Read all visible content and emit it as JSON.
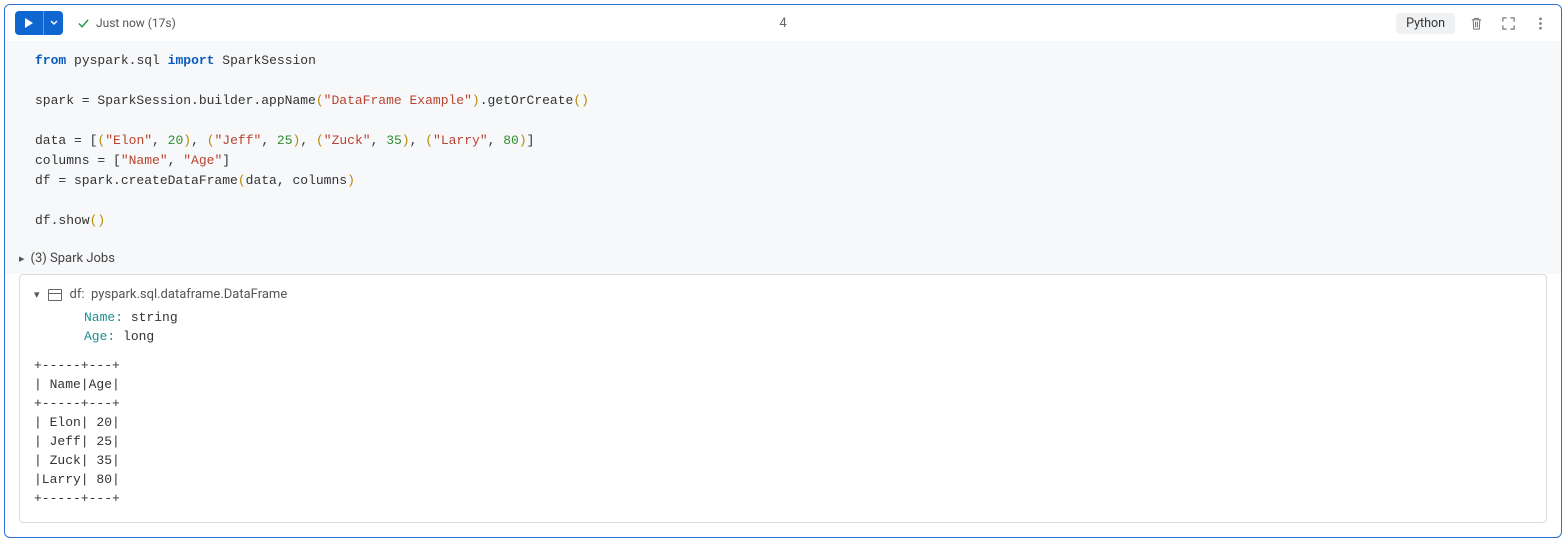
{
  "toolbar": {
    "status_text": "Just now (17s)",
    "execution_count": "4",
    "language": "Python"
  },
  "code": {
    "line1_from": "from",
    "line1_mod": "pyspark.sql",
    "line1_import": "import",
    "line1_cls": "SparkSession",
    "line3_a": "spark = SparkSession.builder.appName",
    "line3_op": "(",
    "line3_str": "\"DataFrame Example\"",
    "line3_cp": ")",
    "line3_b": ".getOrCreate",
    "line3_op2": "(",
    "line3_cp2": ")",
    "line5_data": "data = [",
    "line5_o1": "(",
    "line5_s1": "\"Elon\"",
    "line5_c1": ", ",
    "line5_n1": "20",
    "line5_p1": ")",
    "line5_sep1": ", ",
    "line5_o2": "(",
    "line5_s2": "\"Jeff\"",
    "line5_c2": ", ",
    "line5_n2": "25",
    "line5_p2": ")",
    "line5_sep2": ", ",
    "line5_o3": "(",
    "line5_s3": "\"Zuck\"",
    "line5_c3": ", ",
    "line5_n3": "35",
    "line5_p3": ")",
    "line5_sep3": ", ",
    "line5_o4": "(",
    "line5_s4": "\"Larry\"",
    "line5_c4": ", ",
    "line5_n4": "80",
    "line5_p4": ")",
    "line5_end": "]",
    "line6_a": "columns = [",
    "line6_s1": "\"Name\"",
    "line6_sep": ", ",
    "line6_s2": "\"Age\"",
    "line6_end": "]",
    "line7_a": "df = spark.createDataFrame",
    "line7_op": "(",
    "line7_args": "data, columns",
    "line7_cp": ")",
    "line9_a": "df.show",
    "line9_op": "(",
    "line9_cp": ")"
  },
  "spark_jobs": {
    "label": "(3) Spark Jobs"
  },
  "output": {
    "df_label": "df:",
    "df_type": "pyspark.sql.dataframe.DataFrame",
    "schema": [
      {
        "key": "Name:",
        "type": "string"
      },
      {
        "key": "Age:",
        "type": "long"
      }
    ],
    "table_text": "+-----+---+\n| Name|Age|\n+-----+---+\n| Elon| 20|\n| Jeff| 25|\n| Zuck| 35|\n|Larry| 80|\n+-----+---+"
  }
}
